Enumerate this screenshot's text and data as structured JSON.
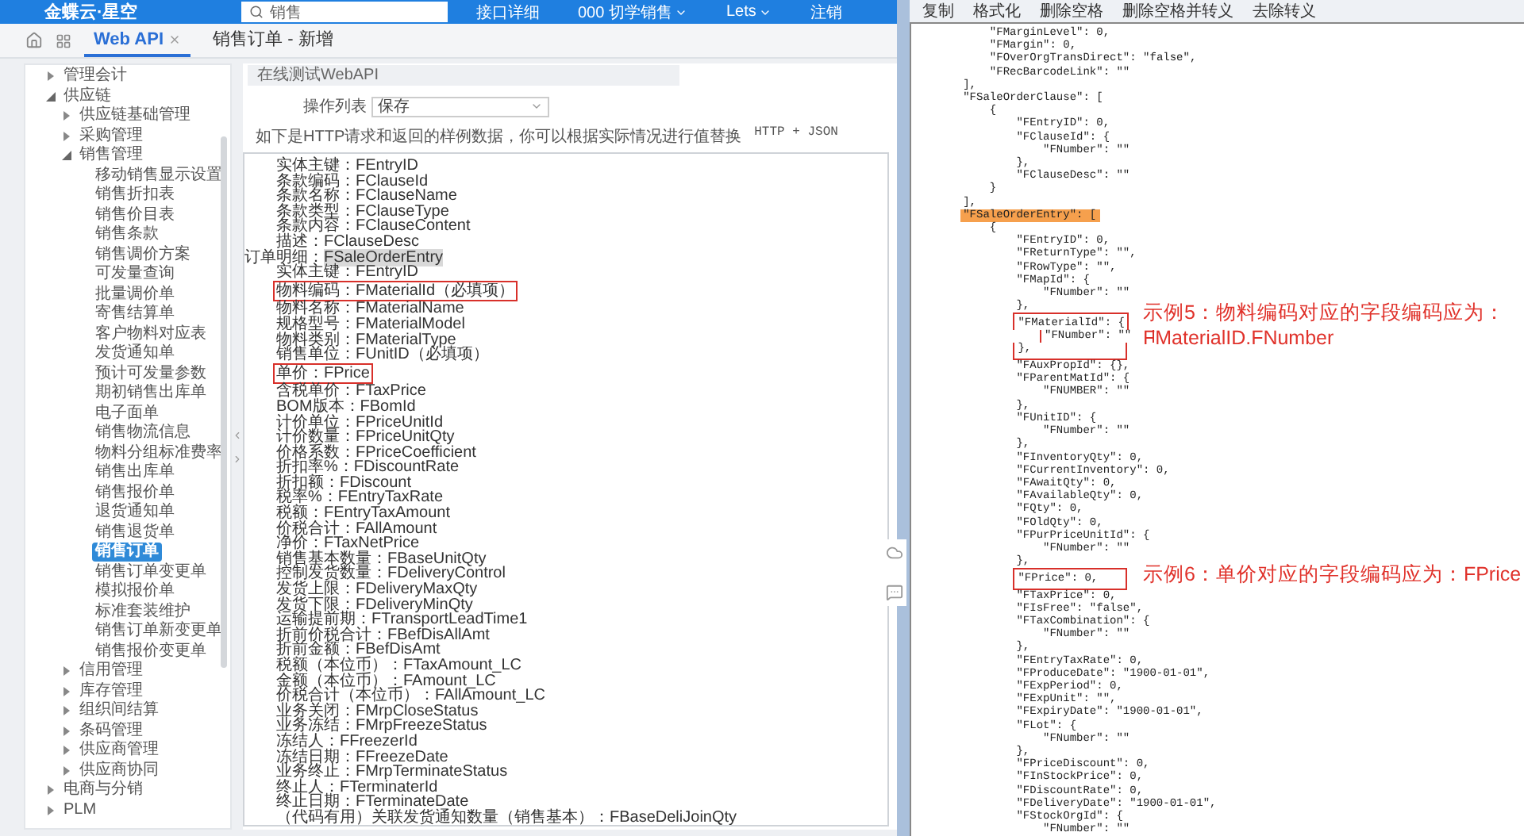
{
  "header": {
    "logo": "金蝶云·星空",
    "search": {
      "value": "销售"
    },
    "links": [
      {
        "label": "接口详细",
        "caret": false
      },
      {
        "label": "000 切学销售",
        "caret": true
      },
      {
        "label": "Lets",
        "caret": true
      },
      {
        "label": "注销",
        "caret": false
      }
    ]
  },
  "tabs": [
    {
      "label": "Web API",
      "selected": true,
      "closable": true
    },
    {
      "label": "销售订单 - 新增",
      "selected": false,
      "closable": false
    }
  ],
  "sidebar": {
    "items": [
      {
        "label": "管理会计",
        "expanded": false,
        "selected": false
      },
      {
        "label": "供应链",
        "expanded": true,
        "selected": false,
        "children": [
          {
            "label": "供应链基础管理",
            "expanded": false,
            "selected": false
          },
          {
            "label": "采购管理",
            "expanded": false,
            "selected": false
          },
          {
            "label": "销售管理",
            "expanded": true,
            "selected": false,
            "children": [
              {
                "label": "移动销售显示设置",
                "selected": false
              },
              {
                "label": "销售折扣表",
                "selected": false
              },
              {
                "label": "销售价目表",
                "selected": false
              },
              {
                "label": "销售条款",
                "selected": false
              },
              {
                "label": "销售调价方案",
                "selected": false
              },
              {
                "label": "可发量查询",
                "selected": false
              },
              {
                "label": "批量调价单",
                "selected": false
              },
              {
                "label": "寄售结算单",
                "selected": false
              },
              {
                "label": "客户物料对应表",
                "selected": false
              },
              {
                "label": "发货通知单",
                "selected": false
              },
              {
                "label": "预计可发量参数",
                "selected": false
              },
              {
                "label": "期初销售出库单",
                "selected": false
              },
              {
                "label": "电子面单",
                "selected": false
              },
              {
                "label": "销售物流信息",
                "selected": false
              },
              {
                "label": "物料分组标准费率",
                "selected": false
              },
              {
                "label": "销售出库单",
                "selected": false
              },
              {
                "label": "销售报价单",
                "selected": false
              },
              {
                "label": "退货通知单",
                "selected": false
              },
              {
                "label": "销售退货单",
                "selected": false
              },
              {
                "label": "销售订单",
                "selected": true
              },
              {
                "label": "销售订单变更单",
                "selected": false
              },
              {
                "label": "模拟报价单",
                "selected": false
              },
              {
                "label": "标准套装维护",
                "selected": false
              },
              {
                "label": "销售订单新变更单",
                "selected": false
              },
              {
                "label": "销售报价变更单",
                "selected": false
              }
            ]
          },
          {
            "label": "信用管理",
            "expanded": false,
            "selected": false
          },
          {
            "label": "库存管理",
            "expanded": false,
            "selected": false
          },
          {
            "label": "组织间结算",
            "expanded": false,
            "selected": false
          },
          {
            "label": "条码管理",
            "expanded": false,
            "selected": false
          },
          {
            "label": "供应商管理",
            "expanded": false,
            "selected": false
          },
          {
            "label": "供应商协同",
            "expanded": false,
            "selected": false
          }
        ]
      },
      {
        "label": "电商与分销",
        "expanded": false,
        "selected": false
      },
      {
        "label": "PLM",
        "expanded": false,
        "selected": false
      }
    ]
  },
  "api_panel": {
    "title": "在线测试WebAPI",
    "operation": {
      "label": "操作列表",
      "value": "保存"
    },
    "hint": "如下是HTTP请求和返回的样例数据，你可以根据实际情况进行值替换",
    "format": "HTTP + JSON",
    "fields": {
      "continued": [
        "实体主键：FEntryID",
        "条款编码：FClauseId",
        "条款名称：FClauseName",
        "条款类型：FClauseType",
        "条款内容：FClauseContent",
        "描述：FClauseDesc"
      ],
      "groups": [
        {
          "label": "订单明细：",
          "code": "FSaleOrderEntry",
          "highlighted": true,
          "children": [
            {
              "text": "实体主键：FEntryID",
              "boxed": false
            },
            {
              "text": "物料编码：FMaterialId（必填项）",
              "boxed": true
            },
            {
              "text": "物料名称：FMaterialName",
              "boxed": false
            },
            {
              "text": "规格型号：FMaterialModel",
              "boxed": false
            },
            {
              "text": "物料类别：FMaterialType",
              "boxed": false
            },
            {
              "text": "销售单位：FUnitID（必填项）",
              "boxed": false
            },
            {
              "text": "单价：FPrice",
              "boxed": true
            },
            {
              "text": "含税单价：FTaxPrice",
              "boxed": false
            },
            {
              "text": "BOM版本：FBomId",
              "boxed": false
            },
            {
              "text": "计价单位：FPriceUnitId",
              "boxed": false
            },
            {
              "text": "计价数量：FPriceUnitQty",
              "boxed": false
            },
            {
              "text": "价格系数：FPriceCoefficient",
              "boxed": false
            },
            {
              "text": "折扣率%：FDiscountRate",
              "boxed": false
            },
            {
              "text": "折扣额：FDiscount",
              "boxed": false
            },
            {
              "text": "税率%：FEntryTaxRate",
              "boxed": false
            },
            {
              "text": "税额：FEntryTaxAmount",
              "boxed": false
            },
            {
              "text": "价税合计：FAllAmount",
              "boxed": false
            },
            {
              "text": "净价：FTaxNetPrice",
              "boxed": false
            },
            {
              "text": "销售基本数量：FBaseUnitQty",
              "boxed": false
            },
            {
              "text": "控制发货数量：FDeliveryControl",
              "boxed": false
            },
            {
              "text": "发货上限：FDeliveryMaxQty",
              "boxed": false
            },
            {
              "text": "发货下限：FDeliveryMinQty",
              "boxed": false
            },
            {
              "text": "运输提前期：FTransportLeadTime1",
              "boxed": false
            },
            {
              "text": "折前价税合计：FBefDisAllAmt",
              "boxed": false
            },
            {
              "text": "折前金额：FBefDisAmt",
              "boxed": false
            },
            {
              "text": "税额（本位币）：FTaxAmount_LC",
              "boxed": false
            },
            {
              "text": "金额（本位币）：FAmount_LC",
              "boxed": false
            },
            {
              "text": "价税合计（本位币）：FAllAmount_LC",
              "boxed": false
            },
            {
              "text": "业务关闭：FMrpCloseStatus",
              "boxed": false
            },
            {
              "text": "业务冻结：FMrpFreezeStatus",
              "boxed": false
            },
            {
              "text": "冻结人：FFreezerId",
              "boxed": false
            },
            {
              "text": "冻结日期：FFreezeDate",
              "boxed": false
            },
            {
              "text": "业务终止：FMrpTerminateStatus",
              "boxed": false
            },
            {
              "text": "终止人：FTerminaterId",
              "boxed": false
            },
            {
              "text": "终止日期：FTerminateDate",
              "boxed": false
            },
            {
              "text": "（代码有用）关联发货通知数量（销售基本）：FBaseDeliJoinQty",
              "boxed": false
            }
          ]
        }
      ]
    }
  },
  "json_viewer": {
    "toolbar": [
      "复制",
      "格式化",
      "删除空格",
      "删除空格并转义",
      "去除转义"
    ],
    "lines": [
      {
        "text": "            \"FMarginLevel\": 0,",
        "highlighted": false,
        "boxed": false
      },
      {
        "text": "            \"FMargin\": 0,",
        "highlighted": false,
        "boxed": false
      },
      {
        "text": "            \"FOverOrgTransDirect\": \"false\",",
        "highlighted": false,
        "boxed": false
      },
      {
        "text": "            \"FRecBarcodeLink\": \"\"",
        "highlighted": false,
        "boxed": false
      },
      {
        "text": "        ],",
        "highlighted": false,
        "boxed": false
      },
      {
        "text": "        \"FSaleOrderClause\": [",
        "highlighted": false,
        "boxed": false
      },
      {
        "text": "            {",
        "highlighted": false,
        "boxed": false
      },
      {
        "text": "                \"FEntryID\": 0,",
        "highlighted": false,
        "boxed": false
      },
      {
        "text": "                \"FClauseId\": {",
        "highlighted": false,
        "boxed": false
      },
      {
        "text": "                    \"FNumber\": \"\"",
        "highlighted": false,
        "boxed": false
      },
      {
        "text": "                },",
        "highlighted": false,
        "boxed": false
      },
      {
        "text": "                \"FClauseDesc\": \"\"",
        "highlighted": false,
        "boxed": false
      },
      {
        "text": "            }",
        "highlighted": false,
        "boxed": false
      },
      {
        "text": "        ],",
        "highlighted": false,
        "boxed": false
      },
      {
        "text": "        \"FSaleOrderEntry\": [",
        "highlighted": true,
        "boxed": false
      },
      {
        "text": "            {",
        "highlighted": false,
        "boxed": false
      },
      {
        "text": "                \"FEntryID\": 0,",
        "highlighted": false,
        "boxed": false
      },
      {
        "text": "                \"FReturnType\": \"\",",
        "highlighted": false,
        "boxed": false
      },
      {
        "text": "                \"FRowType\": \"\",",
        "highlighted": false,
        "boxed": false
      },
      {
        "text": "                \"FMapId\": {",
        "highlighted": false,
        "boxed": false
      },
      {
        "text": "                    \"FNumber\": \"\"",
        "highlighted": false,
        "boxed": false
      },
      {
        "text": "                },",
        "highlighted": false,
        "boxed": false
      },
      {
        "text": "                \"FMaterialId\": {",
        "highlighted": false,
        "boxed": true,
        "note": [
          "示例5：物料编码对应的字段编码应为：",
          "FMaterialID.FNumber"
        ]
      },
      {
        "text": "                    \"FNumber\": \"\"",
        "highlighted": false,
        "boxed": true
      },
      {
        "text": "                },",
        "highlighted": false,
        "boxed": true
      },
      {
        "text": "                \"FAuxPropId\": {},",
        "highlighted": false,
        "boxed": false
      },
      {
        "text": "                \"FParentMatId\": {",
        "highlighted": false,
        "boxed": false
      },
      {
        "text": "                    \"FNUMBER\": \"\"",
        "highlighted": false,
        "boxed": false
      },
      {
        "text": "                },",
        "highlighted": false,
        "boxed": false
      },
      {
        "text": "                \"FUnitID\": {",
        "highlighted": false,
        "boxed": false
      },
      {
        "text": "                    \"FNumber\": \"\"",
        "highlighted": false,
        "boxed": false
      },
      {
        "text": "                },",
        "highlighted": false,
        "boxed": false
      },
      {
        "text": "                \"FInventoryQty\": 0,",
        "highlighted": false,
        "boxed": false
      },
      {
        "text": "                \"FCurrentInventory\": 0,",
        "highlighted": false,
        "boxed": false
      },
      {
        "text": "                \"FAwaitQty\": 0,",
        "highlighted": false,
        "boxed": false
      },
      {
        "text": "                \"FAvailableQty\": 0,",
        "highlighted": false,
        "boxed": false
      },
      {
        "text": "                \"FQty\": 0,",
        "highlighted": false,
        "boxed": false
      },
      {
        "text": "                \"FOldQty\": 0,",
        "highlighted": false,
        "boxed": false
      },
      {
        "text": "                \"FPurPriceUnitId\": {",
        "highlighted": false,
        "boxed": false
      },
      {
        "text": "                    \"FNumber\": \"\"",
        "highlighted": false,
        "boxed": false
      },
      {
        "text": "                },",
        "highlighted": false,
        "boxed": false
      },
      {
        "text": "                \"FPrice\": 0,",
        "highlighted": false,
        "boxed": true,
        "note": [
          "示例6：单价对应的字段编码应为：FPrice"
        ]
      },
      {
        "text": "                \"FTaxPrice\": 0,",
        "highlighted": false,
        "boxed": false
      },
      {
        "text": "                \"FIsFree\": \"false\",",
        "highlighted": false,
        "boxed": false
      },
      {
        "text": "                \"FTaxCombination\": {",
        "highlighted": false,
        "boxed": false
      },
      {
        "text": "                    \"FNumber\": \"\"",
        "highlighted": false,
        "boxed": false
      },
      {
        "text": "                },",
        "highlighted": false,
        "boxed": false
      },
      {
        "text": "                \"FEntryTaxRate\": 0,",
        "highlighted": false,
        "boxed": false
      },
      {
        "text": "                \"FProduceDate\": \"1900-01-01\",",
        "highlighted": false,
        "boxed": false
      },
      {
        "text": "                \"FExpPeriod\": 0,",
        "highlighted": false,
        "boxed": false
      },
      {
        "text": "                \"FExpUnit\": \"\",",
        "highlighted": false,
        "boxed": false
      },
      {
        "text": "                \"FExpiryDate\": \"1900-01-01\",",
        "highlighted": false,
        "boxed": false
      },
      {
        "text": "                \"FLot\": {",
        "highlighted": false,
        "boxed": false
      },
      {
        "text": "                    \"FNumber\": \"\"",
        "highlighted": false,
        "boxed": false
      },
      {
        "text": "                },",
        "highlighted": false,
        "boxed": false
      },
      {
        "text": "                \"FPriceDiscount\": 0,",
        "highlighted": false,
        "boxed": false
      },
      {
        "text": "                \"FInStockPrice\": 0,",
        "highlighted": false,
        "boxed": false
      },
      {
        "text": "                \"FDiscountRate\": 0,",
        "highlighted": false,
        "boxed": false
      },
      {
        "text": "                \"FDeliveryDate\": \"1900-01-01\",",
        "highlighted": false,
        "boxed": false
      },
      {
        "text": "                \"FStockOrgId\": {",
        "highlighted": false,
        "boxed": false
      },
      {
        "text": "                    \"FNumber\": \"\"",
        "highlighted": false,
        "boxed": false
      }
    ]
  }
}
